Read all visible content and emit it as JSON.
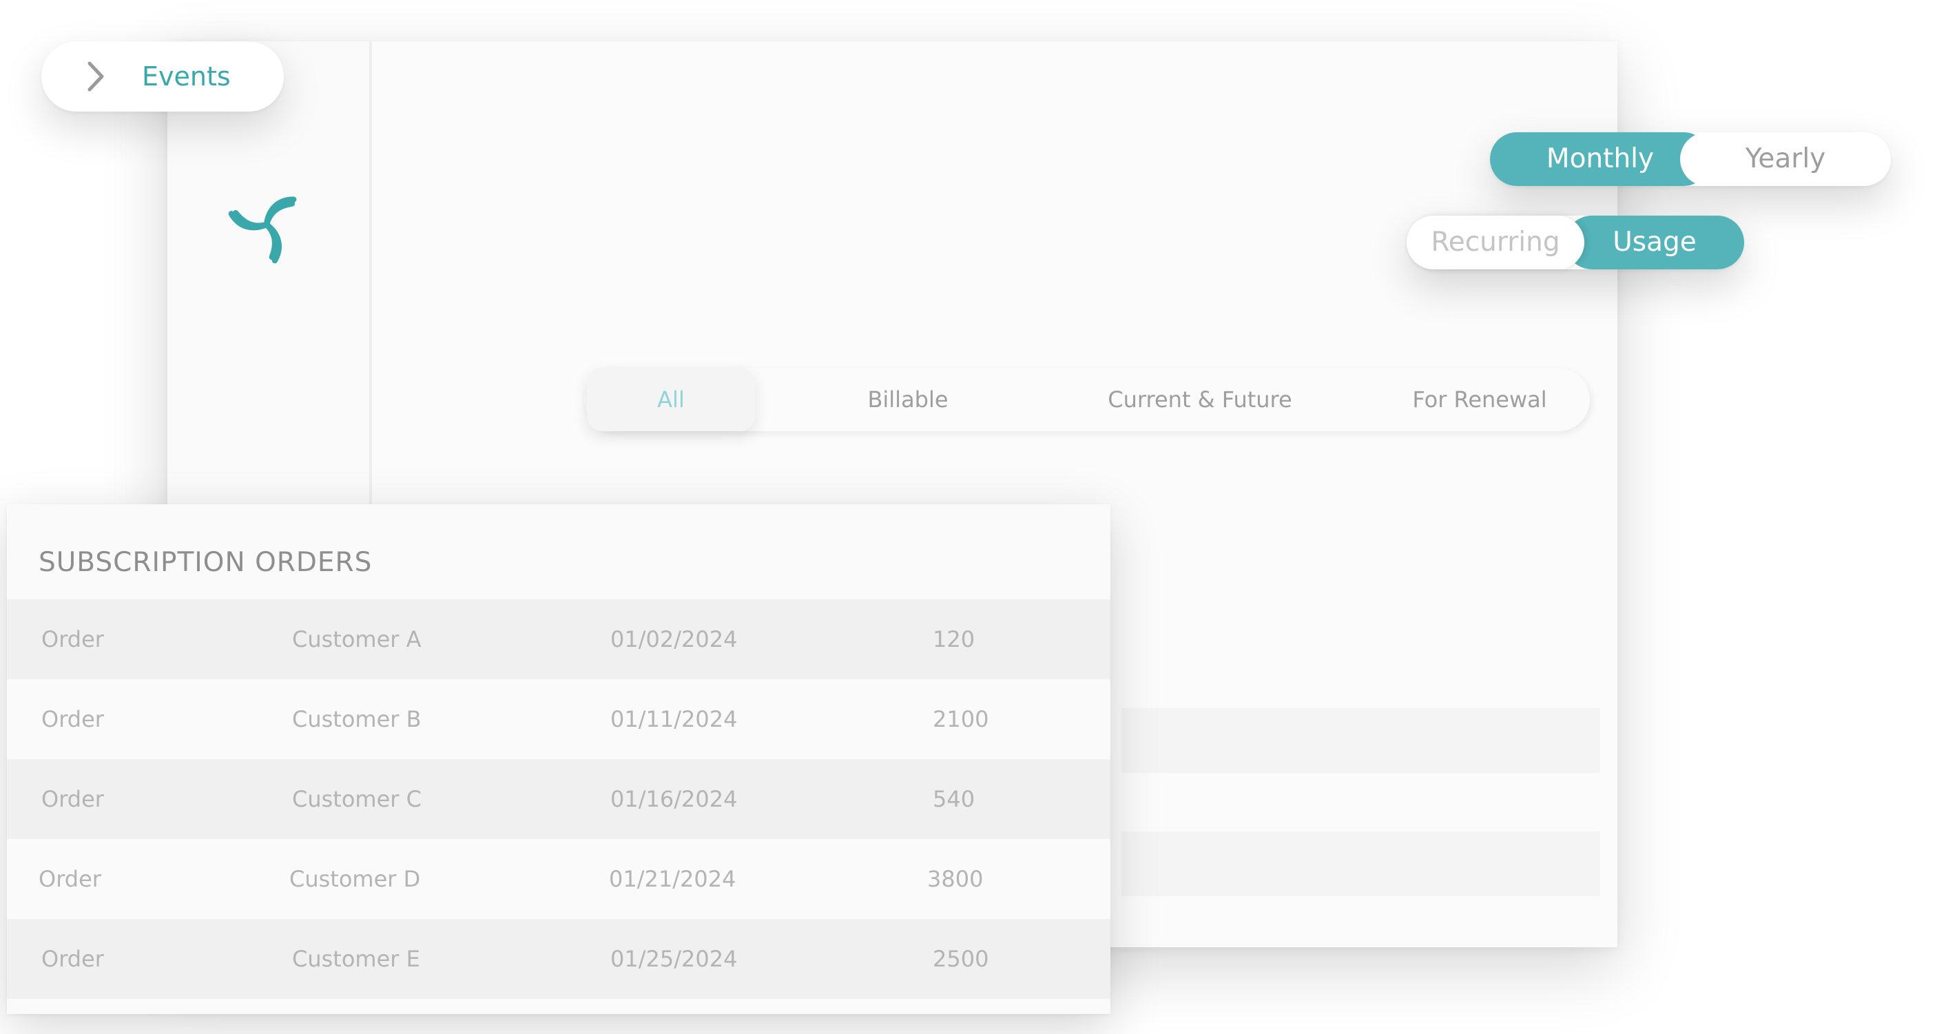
{
  "nav": {
    "events_label": "Events",
    "chevron_icon": "chevron-right-icon"
  },
  "sidebar": {
    "logo_icon": "spiral-logo-icon"
  },
  "billing_period": {
    "options": [
      {
        "label": "Monthly",
        "active": true
      },
      {
        "label": "Yearly",
        "active": false
      }
    ]
  },
  "billing_type": {
    "options": [
      {
        "label": "Recurring",
        "active": false
      },
      {
        "label": "Usage",
        "active": true
      }
    ]
  },
  "filters": {
    "tabs": [
      {
        "label": "All",
        "active": true
      },
      {
        "label": "Billable",
        "active": false
      },
      {
        "label": "Current & Future",
        "active": false
      },
      {
        "label": "For Renewal",
        "active": false
      }
    ]
  },
  "orders": {
    "title": "SUBSCRIPTION ORDERS",
    "rows": [
      {
        "type": "Order",
        "customer": "Customer A",
        "date": "01/02/2024",
        "amount": "120"
      },
      {
        "type": "Order",
        "customer": "Customer B",
        "date": "01/11/2024",
        "amount": "2100"
      },
      {
        "type": "Order",
        "customer": "Customer C",
        "date": "01/16/2024",
        "amount": "540"
      },
      {
        "type": "Order",
        "customer": "Customer D",
        "date": "01/21/2024",
        "amount": "3800"
      },
      {
        "type": "Order",
        "customer": "Customer E",
        "date": "01/25/2024",
        "amount": "2500"
      }
    ]
  },
  "colors": {
    "accent": "#54b4b9",
    "accent_text": "#3aa7ab",
    "active_tab_text": "#90d3dd",
    "muted_text": "#9d9d9d"
  }
}
